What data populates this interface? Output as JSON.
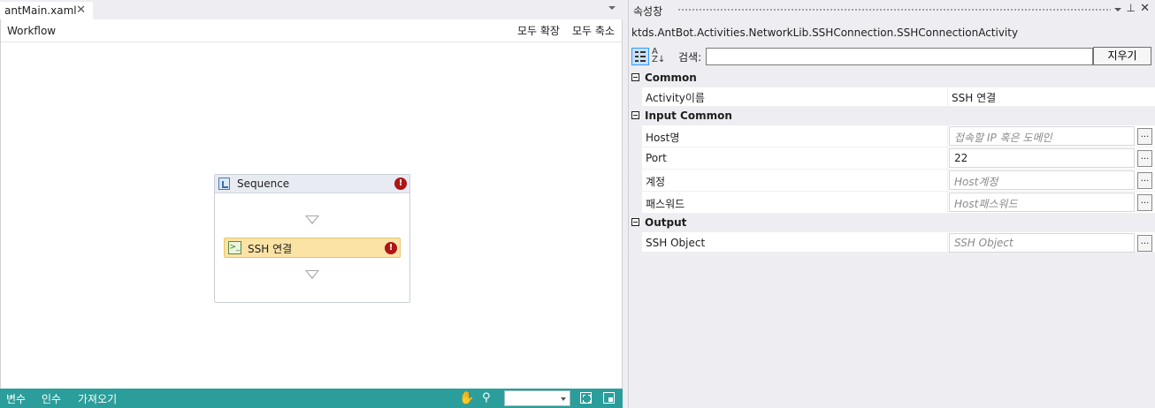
{
  "document_tab": {
    "title": "antMain.xaml",
    "close": "✕"
  },
  "designer": {
    "breadcrumb": "Workflow",
    "expand_all": "모두 확장",
    "collapse_all": "모두 축소",
    "sequence": {
      "title": "Sequence",
      "error": "!"
    },
    "activity": {
      "title": "SSH 연결",
      "icon": ">_",
      "error": "!"
    }
  },
  "status_bar": {
    "tabs": [
      "변수",
      "인수",
      "가져오기"
    ],
    "zoom_value": ""
  },
  "properties": {
    "title": "속성창",
    "type_name": "ktds.AntBot.Activities.NetworkLib.SSHConnection.SSHConnectionActivity",
    "search_label": "검색:",
    "search_value": "",
    "clear_button": "지우기",
    "az_glyph": "A\nZ↓",
    "pin": "⊥",
    "close": "✕",
    "categories": [
      {
        "name": "Common",
        "props": [
          {
            "name": "Activity이름",
            "value": "SSH 연결",
            "placeholder": false,
            "editor": false
          }
        ]
      },
      {
        "name": "Input Common",
        "props": [
          {
            "name": "Host명",
            "value": "접속할 IP 혹은 도메인",
            "placeholder": true,
            "editor": true
          },
          {
            "name": "Port",
            "value": "22",
            "placeholder": false,
            "editor": true
          },
          {
            "name": "계정",
            "value": "Host계정",
            "placeholder": true,
            "editor": true
          },
          {
            "name": "패스워드",
            "value": "Host패스워드",
            "placeholder": true,
            "editor": true
          }
        ]
      },
      {
        "name": "Output",
        "props": [
          {
            "name": "SSH Object",
            "value": "SSH Object",
            "placeholder": true,
            "editor": true
          }
        ]
      }
    ]
  },
  "icons": {
    "hand": "hand-pan-icon",
    "zoom": "magnifier-icon",
    "fit": "fit-to-screen-icon",
    "overview": "overview-map-icon"
  },
  "colors": {
    "status_bar": "#2b9e9b",
    "activity_fill": "#fbe3a6",
    "error_red": "#b01414"
  }
}
